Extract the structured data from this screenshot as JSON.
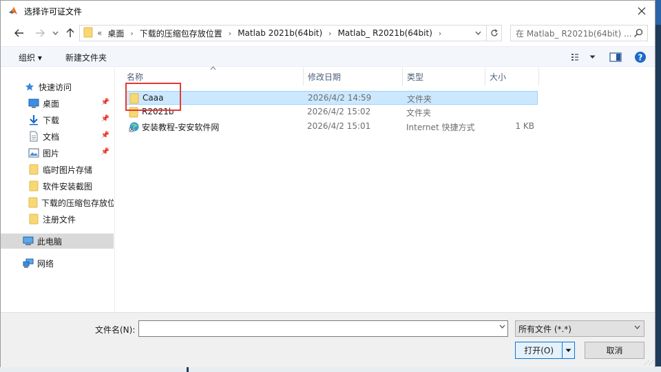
{
  "window": {
    "title": "选择许可证文件"
  },
  "address": {
    "overflow": "«",
    "crumbs": [
      "桌面",
      "下载的压缩包存放位置",
      "Matlab 2021b(64bit)",
      "Matlab_ R2021b(64bit)"
    ],
    "separator": "›"
  },
  "search": {
    "placeholder": "在 Matlab_ R2021b(64bit) ..."
  },
  "toolbar": {
    "organize": "组织 ▾",
    "new_folder": "新建文件夹"
  },
  "nav": {
    "quick_access": "快速访问",
    "items": [
      {
        "label": "桌面",
        "icon": "desktop-icon",
        "pinned": true
      },
      {
        "label": "下载",
        "icon": "download-icon",
        "pinned": true
      },
      {
        "label": "文档",
        "icon": "document-icon",
        "pinned": true
      },
      {
        "label": "图片",
        "icon": "picture-icon",
        "pinned": true
      },
      {
        "label": "临时图片存储",
        "icon": "folder-icon",
        "pinned": false
      },
      {
        "label": "软件安装截图",
        "icon": "folder-icon",
        "pinned": false
      },
      {
        "label": "下载的压缩包存放位置",
        "icon": "folder-icon",
        "pinned": false
      },
      {
        "label": "注册文件",
        "icon": "folder-icon",
        "pinned": false
      }
    ],
    "this_pc": "此电脑",
    "network": "网络"
  },
  "columns": {
    "name": "名称",
    "date": "修改日期",
    "type": "类型",
    "size": "大小"
  },
  "files": [
    {
      "name": "Caaa",
      "date": "2026/4/2 14:59",
      "type": "文件夹",
      "size": "",
      "icon": "folder-icon",
      "selected": true
    },
    {
      "name": "R2021b",
      "date": "2026/4/2 15:02",
      "type": "文件夹",
      "size": "",
      "icon": "folder-icon",
      "selected": false
    },
    {
      "name": "安装教程-安安软件网",
      "date": "2026/4/2 15:01",
      "type": "Internet 快捷方式",
      "size": "1 KB",
      "icon": "internet-shortcut-icon",
      "selected": false
    }
  ],
  "bottom": {
    "filename_label": "文件名(N):",
    "filename_value": "",
    "filter": "所有文件 (*.*)",
    "open": "打开(O)",
    "cancel": "取消"
  },
  "colors": {
    "accent": "#0078d7",
    "selection": "#cce8ff",
    "highlight_box": "#e53935",
    "folder": "#f8d775"
  }
}
